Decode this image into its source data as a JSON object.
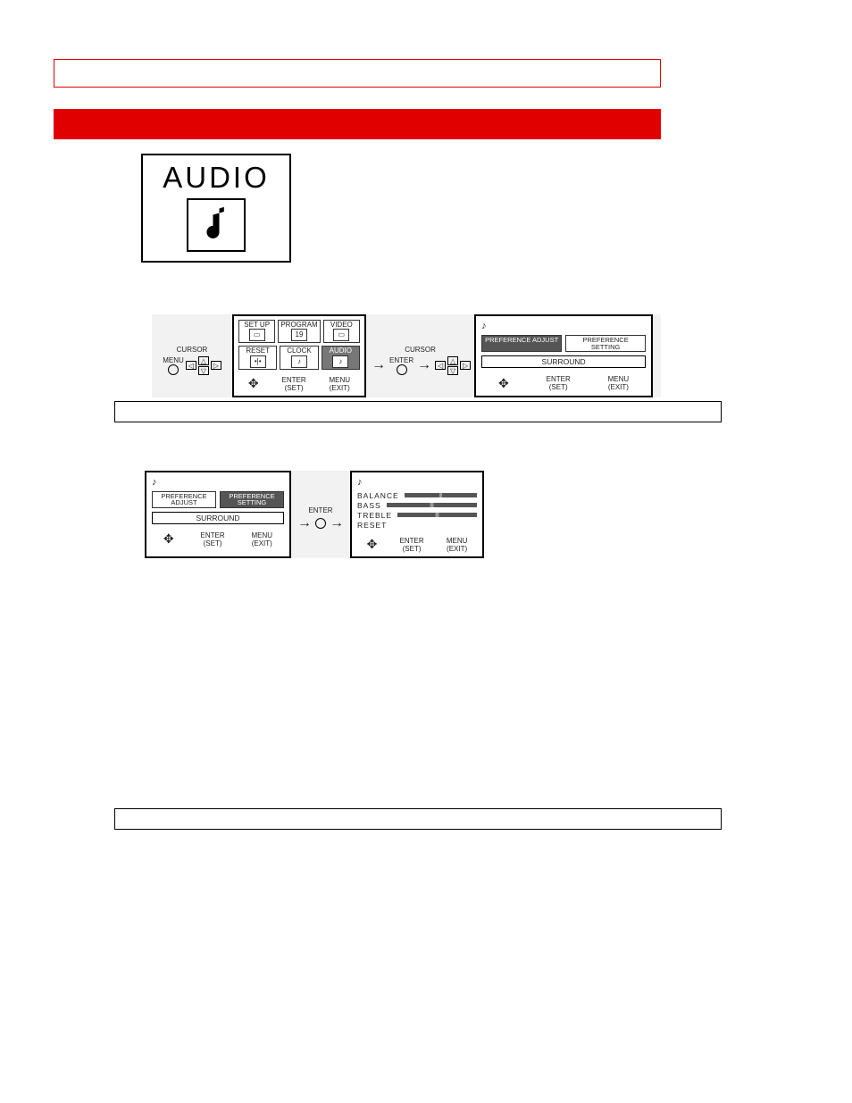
{
  "audio_tile": {
    "label": "AUDIO"
  },
  "figure1": {
    "left_label_top": "CURSOR",
    "menu_label": "MENU",
    "grid": {
      "row1": [
        "SET UP",
        "PROGRAM",
        "VIDEO"
      ],
      "row2": [
        "RESET",
        "CLOCK",
        "AUDIO"
      ],
      "selected": "AUDIO"
    },
    "mid_label_top": "CURSOR",
    "enter_label": "ENTER",
    "osd2": {
      "pref_adjust": "PREFERENCE ADJUST",
      "pref_setting": "PREFERENCE SETTING",
      "selected": "ADJUST",
      "surround": "SURROUND"
    },
    "footer": {
      "enter": "ENTER",
      "set": "(SET)",
      "menu": "MENU",
      "exit": "(EXIT)"
    }
  },
  "figure2": {
    "osd1": {
      "pref_adjust": "PREFERENCE ADJUST",
      "pref_setting": "PREFERENCE SETTING",
      "selected": "SETTING",
      "surround": "SURROUND"
    },
    "mid_label": "ENTER",
    "osd2_items": [
      "BALANCE",
      "BASS",
      "TREBLE",
      "RESET"
    ],
    "footer": {
      "enter": "ENTER",
      "set": "(SET)",
      "menu": "MENU",
      "exit": "(EXIT)"
    }
  }
}
